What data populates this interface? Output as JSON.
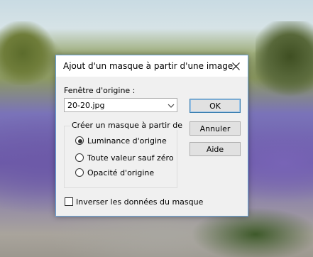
{
  "dialog": {
    "title": "Ajout d'un masque à partir d'une image",
    "source_window_label": "Fenêtre d'origine :",
    "source_window_value": "20-20.jpg",
    "group_label": "Créer un masque à partir de",
    "options": [
      {
        "label": "Luminance d'origine",
        "selected": true
      },
      {
        "label": "Toute valeur sauf zéro",
        "selected": false
      },
      {
        "label": "Opacité d'origine",
        "selected": false
      }
    ],
    "invert_label": "Inverser les données du masque",
    "invert_checked": false,
    "buttons": {
      "ok": "OK",
      "cancel": "Annuler",
      "help": "Aide"
    }
  },
  "icons": {
    "close": "close-icon",
    "dropdown": "chevron-down-icon"
  },
  "colors": {
    "dialog_border": "#6aa4d9",
    "default_button_border": "#3c7fb1"
  }
}
